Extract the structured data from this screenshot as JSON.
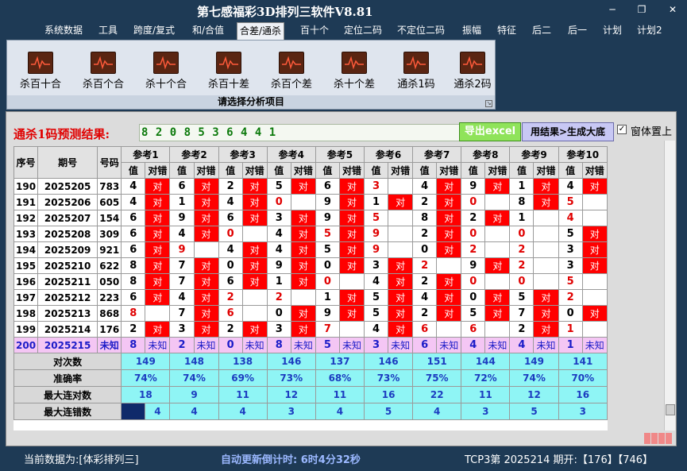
{
  "window": {
    "title": "第七感福彩3D排列三软件V8.81"
  },
  "menu": [
    "系统数据",
    "工具",
    "跨度/复式",
    "和/合值",
    "合差/通杀",
    "百十个",
    "定位二码",
    "不定位二码",
    "振幅",
    "特征",
    "后二",
    "后一",
    "计划",
    "计划2"
  ],
  "menu_active": "合差/通杀",
  "ribbon": {
    "buttons": [
      "杀百十合",
      "杀百个合",
      "杀十个合",
      "杀百十差",
      "杀百个差",
      "杀十个差",
      "通杀1码",
      "通杀2码"
    ],
    "caption": "请选择分析项目"
  },
  "prediction": {
    "label": "通杀1码预测结果:",
    "value": "8 2 0 8 5 3 6 4 4 1",
    "export_button": "导出excel",
    "generate_button": "用结果>生成大底",
    "pin_checkbox_label": "窗体置上",
    "pin_checked": true
  },
  "table": {
    "headers": {
      "seq": "序号",
      "period": "期号",
      "number": "号码",
      "val": "值",
      "hit": "对错"
    },
    "refs": [
      "参考1",
      "参考2",
      "参考3",
      "参考4",
      "参考5",
      "参考6",
      "参考7",
      "参考8",
      "参考9",
      "参考10"
    ],
    "hit_text": "对",
    "rows": [
      {
        "seq": "190",
        "period": "2025205",
        "number": "783",
        "vals": [
          "4",
          "6",
          "2",
          "5",
          "6",
          "3",
          "4",
          "9",
          "1",
          "4"
        ],
        "hits": [
          1,
          1,
          1,
          1,
          1,
          0,
          1,
          1,
          1,
          1
        ]
      },
      {
        "seq": "191",
        "period": "2025206",
        "number": "605",
        "vals": [
          "4",
          "1",
          "4",
          "0",
          "9",
          "1",
          "2",
          "0",
          "8",
          "5"
        ],
        "hits": [
          1,
          1,
          1,
          0,
          1,
          1,
          1,
          0,
          1,
          0
        ]
      },
      {
        "seq": "192",
        "period": "2025207",
        "number": "154",
        "vals": [
          "6",
          "9",
          "6",
          "3",
          "9",
          "5",
          "8",
          "2",
          "1",
          "4"
        ],
        "hits": [
          1,
          1,
          1,
          1,
          1,
          0,
          1,
          1,
          0,
          0
        ]
      },
      {
        "seq": "193",
        "period": "2025208",
        "number": "309",
        "vals": [
          "6",
          "4",
          "0",
          "4",
          "5",
          "9",
          "2",
          "0",
          "0",
          "5"
        ],
        "hits": [
          1,
          1,
          0,
          1,
          1,
          0,
          1,
          0,
          0,
          1
        ]
      },
      {
        "seq": "194",
        "period": "2025209",
        "number": "921",
        "vals": [
          "6",
          "9",
          "4",
          "4",
          "5",
          "9",
          "0",
          "2",
          "2",
          "3"
        ],
        "hits": [
          1,
          0,
          1,
          1,
          1,
          0,
          1,
          0,
          0,
          1
        ]
      },
      {
        "seq": "195",
        "period": "2025210",
        "number": "622",
        "vals": [
          "8",
          "7",
          "0",
          "9",
          "0",
          "3",
          "2",
          "9",
          "2",
          "3"
        ],
        "hits": [
          1,
          1,
          1,
          1,
          1,
          1,
          0,
          1,
          0,
          1
        ]
      },
      {
        "seq": "196",
        "period": "2025211",
        "number": "050",
        "vals": [
          "8",
          "7",
          "6",
          "1",
          "0",
          "4",
          "2",
          "0",
          "0",
          "5"
        ],
        "hits": [
          1,
          1,
          1,
          1,
          0,
          1,
          1,
          0,
          0,
          0
        ]
      },
      {
        "seq": "197",
        "period": "2025212",
        "number": "223",
        "vals": [
          "6",
          "4",
          "2",
          "2",
          "1",
          "5",
          "4",
          "0",
          "5",
          "2"
        ],
        "hits": [
          1,
          1,
          0,
          0,
          1,
          1,
          1,
          1,
          1,
          0
        ]
      },
      {
        "seq": "198",
        "period": "2025213",
        "number": "868",
        "vals": [
          "8",
          "7",
          "6",
          "0",
          "9",
          "5",
          "2",
          "5",
          "7",
          "0"
        ],
        "hits": [
          0,
          1,
          0,
          1,
          1,
          1,
          1,
          1,
          1,
          1
        ]
      },
      {
        "seq": "199",
        "period": "2025214",
        "number": "176",
        "vals": [
          "2",
          "3",
          "2",
          "3",
          "7",
          "4",
          "6",
          "6",
          "2",
          "1"
        ],
        "hits": [
          1,
          1,
          1,
          1,
          0,
          1,
          0,
          0,
          1,
          0
        ]
      }
    ],
    "red_values": [
      [
        false,
        false,
        false,
        false,
        false,
        true,
        false,
        false,
        false,
        false
      ],
      [
        false,
        false,
        false,
        true,
        false,
        false,
        false,
        true,
        false,
        true
      ],
      [
        false,
        false,
        false,
        false,
        false,
        true,
        false,
        false,
        false,
        true
      ],
      [
        false,
        false,
        true,
        false,
        true,
        true,
        false,
        true,
        true,
        false
      ],
      [
        false,
        true,
        false,
        false,
        false,
        true,
        false,
        true,
        true,
        false
      ],
      [
        false,
        false,
        false,
        false,
        false,
        false,
        true,
        false,
        true,
        false
      ],
      [
        false,
        false,
        false,
        false,
        true,
        false,
        false,
        true,
        true,
        true
      ],
      [
        false,
        false,
        true,
        true,
        false,
        false,
        false,
        false,
        false,
        true
      ],
      [
        true,
        false,
        true,
        false,
        false,
        false,
        false,
        false,
        false,
        false
      ],
      [
        false,
        false,
        false,
        false,
        true,
        false,
        true,
        true,
        false,
        true
      ]
    ],
    "unknown_row": {
      "seq": "200",
      "period": "2025215",
      "number": "未知",
      "vals": [
        "8",
        "2",
        "0",
        "8",
        "5",
        "3",
        "6",
        "4",
        "4",
        "1"
      ],
      "status": "未知"
    },
    "stats": [
      {
        "label": "对次数",
        "values": [
          "149",
          "148",
          "138",
          "146",
          "137",
          "146",
          "151",
          "144",
          "149",
          "141"
        ]
      },
      {
        "label": "准确率",
        "values": [
          "74%",
          "74%",
          "69%",
          "73%",
          "68%",
          "73%",
          "75%",
          "72%",
          "74%",
          "70%"
        ]
      },
      {
        "label": "最大连对数",
        "values": [
          "18",
          "9",
          "11",
          "12",
          "11",
          "16",
          "22",
          "11",
          "12",
          "16"
        ]
      },
      {
        "label": "最大连错数",
        "values": [
          "4",
          "4",
          "4",
          "3",
          "4",
          "5",
          "4",
          "3",
          "5",
          "3"
        ]
      }
    ]
  },
  "status": {
    "current_data": "当前数据为:[体彩排列三]",
    "countdown": "自动更新倒计时: 6时4分32秒",
    "period_info": "TCP3第 2025214 期开:【176】【746】"
  }
}
